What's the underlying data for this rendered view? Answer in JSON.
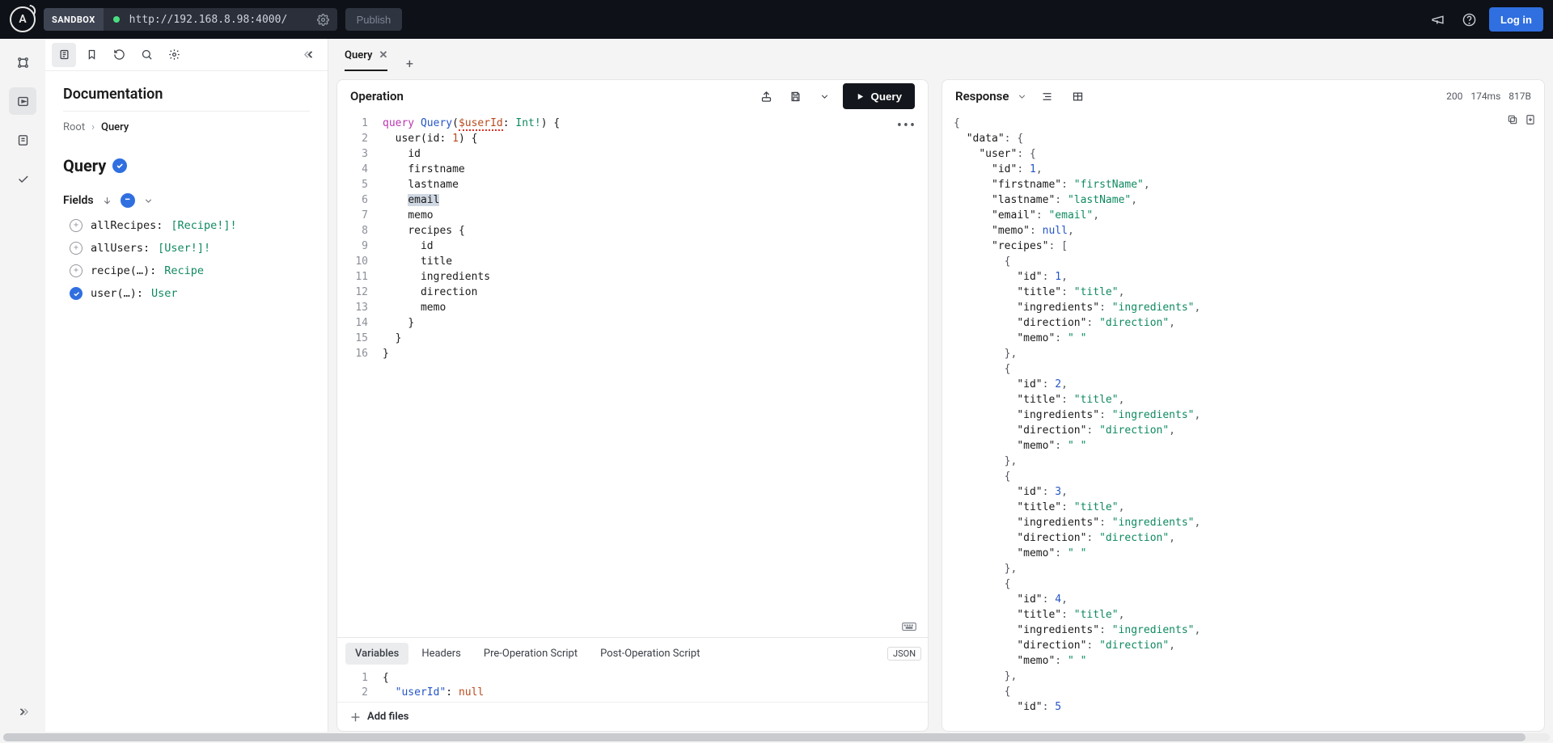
{
  "topbar": {
    "sandbox": "SANDBOX",
    "url": "http://192.168.8.98:4000/",
    "publish": "Publish",
    "login": "Log in"
  },
  "doc": {
    "title": "Documentation",
    "breadcrumb_root": "Root",
    "breadcrumb_current": "Query",
    "type_name": "Query",
    "fields_label": "Fields",
    "fields": [
      {
        "name": "allRecipes:",
        "type": "[Recipe!]!",
        "selected": false,
        "args": false
      },
      {
        "name": "allUsers:",
        "type": "[User!]!",
        "selected": false,
        "args": false
      },
      {
        "name": "recipe(…):",
        "type": "Recipe",
        "selected": false,
        "args": true
      },
      {
        "name": "user(…):",
        "type": "User",
        "selected": true,
        "args": true
      }
    ]
  },
  "tabs": {
    "active": "Query",
    "add": "+"
  },
  "operation": {
    "title": "Operation",
    "run": "Query",
    "code": {
      "kw_query": "query",
      "op_name": "Query",
      "var_name": "$userId",
      "var_type": "Int!",
      "field_user": "user",
      "arg_id": "id",
      "arg_val": "1",
      "f_id": "id",
      "f_first": "firstname",
      "f_last": "lastname",
      "f_email": "email",
      "f_memo": "memo",
      "f_recipes": "recipes",
      "r_id": "id",
      "r_title": "title",
      "r_ing": "ingredients",
      "r_dir": "direction",
      "r_memo": "memo"
    },
    "line_count": 16
  },
  "bottom": {
    "tabs": [
      "Variables",
      "Headers",
      "Pre-Operation Script",
      "Post-Operation Script"
    ],
    "json_chip": "JSON",
    "var_key": "\"userId\"",
    "var_val": "null",
    "add_files": "Add files"
  },
  "response": {
    "title": "Response",
    "status": "200",
    "time": "174ms",
    "size": "817B",
    "data": {
      "user": {
        "id": 1,
        "firstname": "firstName",
        "lastname": "lastName",
        "email": "email",
        "memo": null,
        "recipes": [
          {
            "id": 1,
            "title": "title",
            "ingredients": "ingredients",
            "direction": "direction",
            "memo": " "
          },
          {
            "id": 2,
            "title": "title",
            "ingredients": "ingredients",
            "direction": "direction",
            "memo": " "
          },
          {
            "id": 3,
            "title": "title",
            "ingredients": "ingredients",
            "direction": "direction",
            "memo": " "
          },
          {
            "id": 4,
            "title": "title",
            "ingredients": "ingredients",
            "direction": "direction",
            "memo": " "
          },
          {
            "id": 5
          }
        ]
      }
    }
  }
}
